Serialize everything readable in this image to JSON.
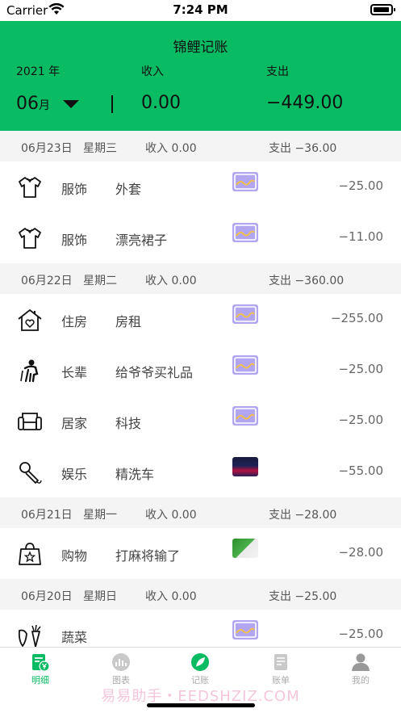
{
  "status": {
    "carrier": "Carrier",
    "time": "7:24 PM"
  },
  "header": {
    "title": "锦鲤记账",
    "year": "2021 年",
    "income_label": "收入",
    "expense_label": "支出",
    "month": "06",
    "month_unit": "月",
    "income_value": "0.00",
    "expense_value": "−449.00"
  },
  "groups": [
    {
      "date": "06月23日",
      "weekday": "星期三",
      "income": "收入 0.00",
      "expense": "支出 −36.00",
      "items": [
        {
          "icon": "shirt-icon",
          "category": "服饰",
          "note": "外套",
          "amount": "−25.00",
          "thumb": "placeholder"
        },
        {
          "icon": "shirt-icon",
          "category": "服饰",
          "note": "漂亮裙子",
          "amount": "−11.00",
          "thumb": "placeholder"
        }
      ]
    },
    {
      "date": "06月22日",
      "weekday": "星期二",
      "income": "收入 0.00",
      "expense": "支出 −360.00",
      "items": [
        {
          "icon": "house-icon",
          "category": "住房",
          "note": "房租",
          "amount": "−255.00",
          "thumb": "placeholder"
        },
        {
          "icon": "elder-icon",
          "category": "长辈",
          "note": "给爷爷买礼品",
          "amount": "−25.00",
          "thumb": "placeholder"
        },
        {
          "icon": "sofa-icon",
          "category": "居家",
          "note": "科技",
          "amount": "−25.00",
          "thumb": "placeholder"
        },
        {
          "icon": "microphone-icon",
          "category": "娱乐",
          "note": "精洗车",
          "amount": "−55.00",
          "thumb": "stage"
        }
      ]
    },
    {
      "date": "06月21日",
      "weekday": "星期一",
      "income": "收入 0.00",
      "expense": "支出 −28.00",
      "items": [
        {
          "icon": "shopping-bag-icon",
          "category": "购物",
          "note": "打麻将输了",
          "amount": "−28.00",
          "thumb": "cards"
        }
      ]
    },
    {
      "date": "06月20日",
      "weekday": "星期日",
      "income": "收入 0.00",
      "expense": "支出 −25.00",
      "items": [
        {
          "icon": "vegetable-icon",
          "category": "蔬菜",
          "note": "",
          "amount": "−25.00",
          "thumb": "placeholder"
        }
      ]
    }
  ],
  "tabs": [
    {
      "label": "明细",
      "icon": "detail-icon",
      "active": true
    },
    {
      "label": "图表",
      "icon": "chart-icon",
      "active": false
    },
    {
      "label": "记账",
      "icon": "leaf-icon",
      "active": false
    },
    {
      "label": "账单",
      "icon": "bill-icon",
      "active": false
    },
    {
      "label": "我的",
      "icon": "profile-icon",
      "active": false
    }
  ],
  "watermark": "易易助手・EEDSHZIZ.COM",
  "colors": {
    "accent": "#09bb62",
    "placeholder": "#b3a6f0",
    "group_bg": "#f4f4f4"
  }
}
